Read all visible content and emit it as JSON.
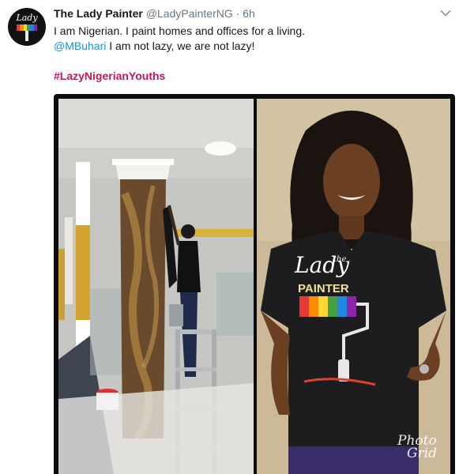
{
  "tweet": {
    "author": {
      "name": "The Lady Painter",
      "handle": "@LadyPainterNG",
      "separator": "·",
      "time": "6h",
      "avatar_text": "Lady"
    },
    "lines": {
      "line1": "I am Nigerian. I paint homes and offices for a living.",
      "mention": "@MBuhari",
      "line2_rest": " I am not lazy, we are not lazy!",
      "hashtag": "#LazyNigerianYouths"
    },
    "menu_icon": "chevron-down-icon",
    "media": {
      "shirt_text_lady": "Lady",
      "shirt_text_the": "the",
      "shirt_text_painter": "PAINTER",
      "watermark_line1": "Photo",
      "watermark_line2": "Grid"
    }
  },
  "colors": {
    "mention": "#1b95e0",
    "hashtag": "#c2185b",
    "secondary_text": "#657786",
    "primary_text": "#14171a"
  }
}
